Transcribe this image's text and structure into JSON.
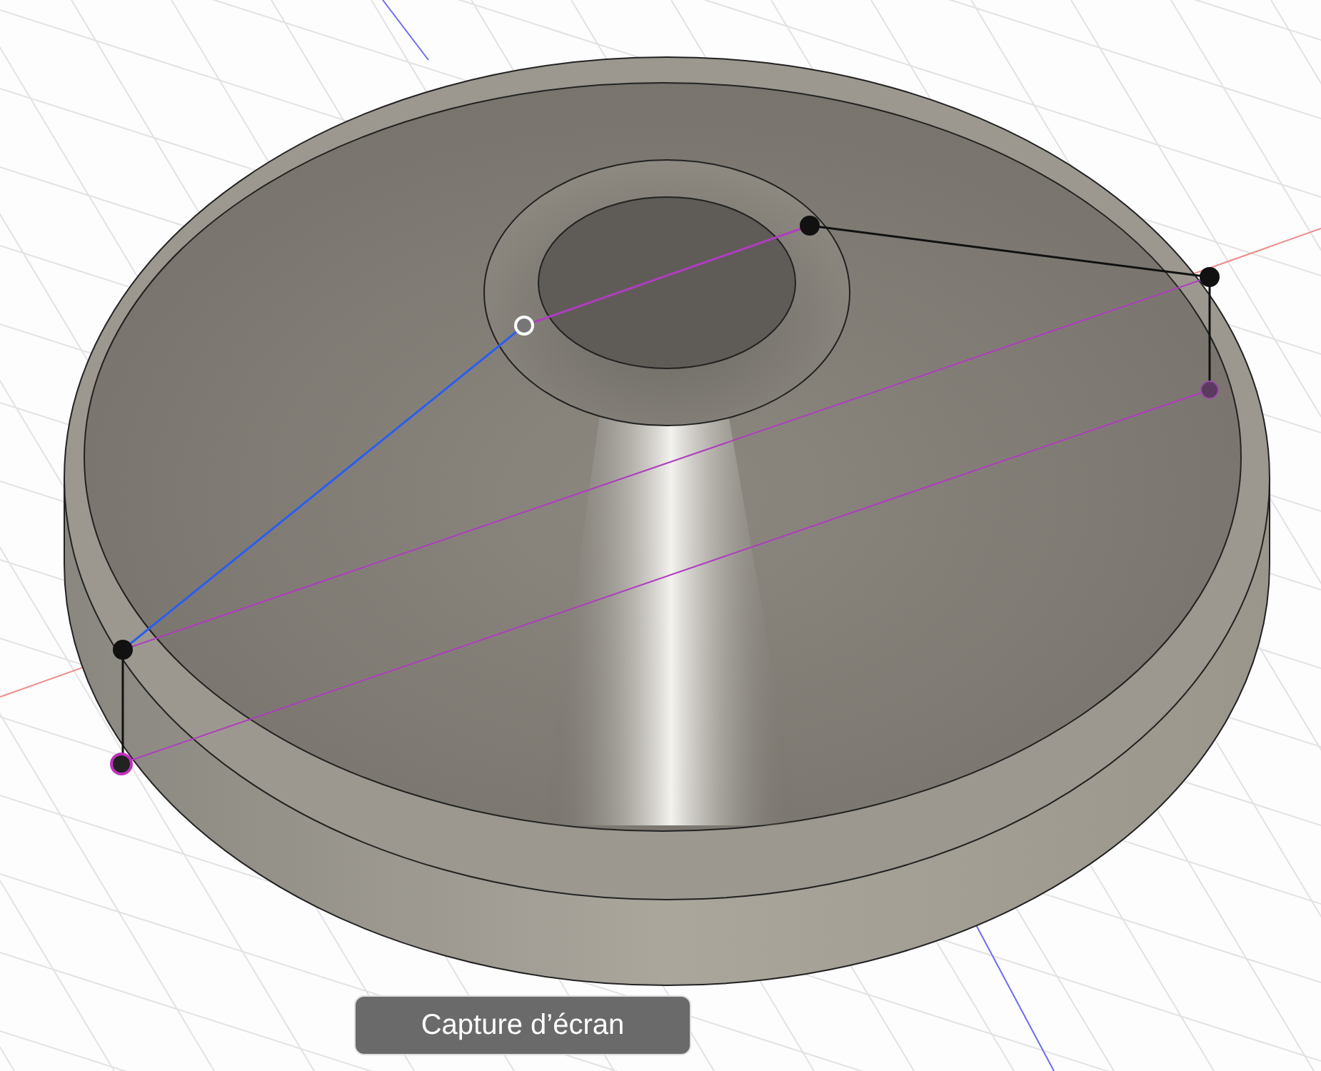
{
  "tooltip": {
    "text": "Capture d’écran"
  }
}
